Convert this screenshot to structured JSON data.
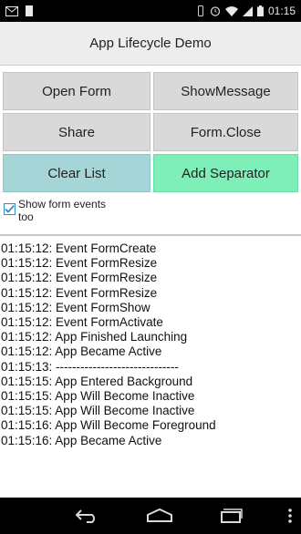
{
  "status_bar": {
    "time": "01:15",
    "icons": [
      "mail-icon",
      "sim-card-icon",
      "vibrate-icon",
      "alarm-icon",
      "wifi-icon",
      "signal-icon",
      "battery-icon"
    ]
  },
  "app": {
    "title": "App Lifecycle Demo"
  },
  "buttons": {
    "open_form": "Open Form",
    "show_message": "ShowMessage",
    "share": "Share",
    "form_close": "Form.Close",
    "clear_list": "Clear List",
    "add_separator": "Add Separator"
  },
  "colors": {
    "clear_list_bg": "#a6d5d8",
    "add_separator_bg": "#7fefba",
    "default_button_bg": "#d9d9d9"
  },
  "checkbox": {
    "label": "Show form events too",
    "checked": true
  },
  "log": [
    "01:15:12: Event FormCreate",
    "01:15:12: Event FormResize",
    "01:15:12: Event FormResize",
    "01:15:12: Event FormResize",
    "01:15:12: Event FormShow",
    "01:15:12: Event FormActivate",
    "01:15:12: App Finished Launching",
    "01:15:12: App Became Active",
    "01:15:13: ------------------------------",
    "01:15:15: App Entered Background",
    "01:15:15: App Will Become Inactive",
    "01:15:15: App Will Become Inactive",
    "01:15:16: App Will Become Foreground",
    "01:15:16: App Became Active"
  ],
  "nav_bar": {
    "icons": [
      "back-icon",
      "home-icon",
      "recent-apps-icon",
      "overflow-menu-icon"
    ]
  }
}
